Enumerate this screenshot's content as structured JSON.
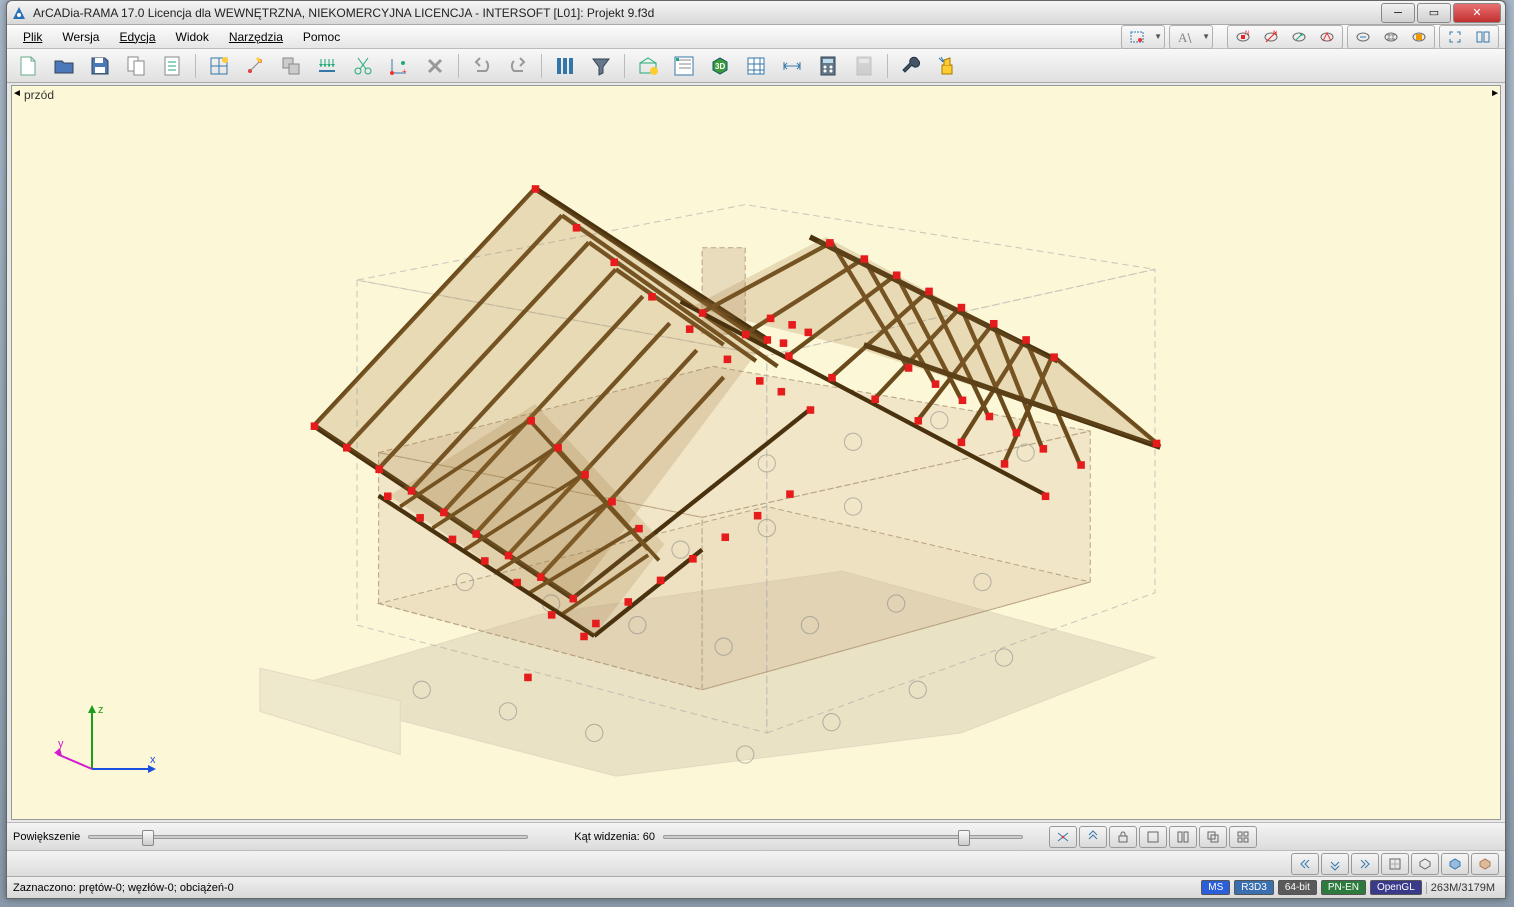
{
  "titlebar": {
    "title": "ArCADia-RAMA 17.0 Licencja dla WEWNĘTRZNA, NIEKOMERCYJNA LICENCJA - INTERSOFT [L01]: Projekt 9.f3d"
  },
  "menu": {
    "plik": "Plik",
    "wersja": "Wersja",
    "edycja": "Edycja",
    "widok": "Widok",
    "narzedzia": "Narzędzia",
    "pomoc": "Pomoc"
  },
  "viewport": {
    "label": "przód"
  },
  "controls": {
    "zoom_label": "Powiększenie",
    "fov_label": "Kąt widzenia: 60"
  },
  "status": {
    "selection": "Zaznaczono: prętów-0; węzłów-0; obciążeń-0",
    "badges": {
      "ms": "MS",
      "r3": "R3D3",
      "bit": "64-bit",
      "pn": "PN-EN",
      "gl": "OpenGL"
    },
    "memory": "263M/3179M"
  },
  "axis": {
    "x": "x",
    "y": "y",
    "z": "z"
  }
}
